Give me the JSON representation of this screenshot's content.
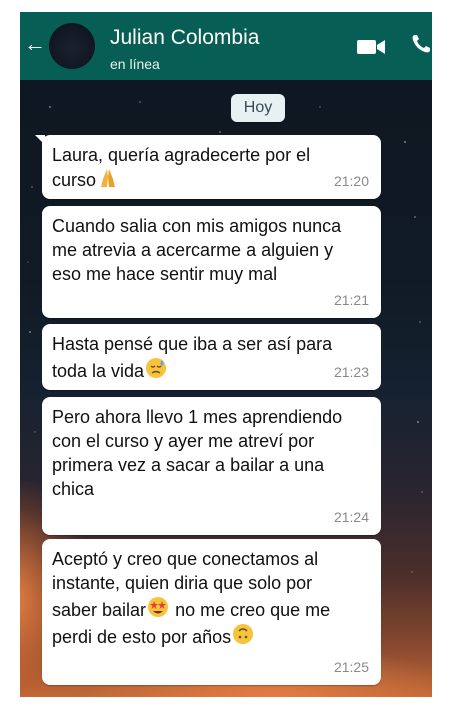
{
  "header": {
    "contact_name": "Julian Colombia",
    "status": "en línea",
    "back_icon": "arrow-left-icon",
    "video_icon": "video-call-icon",
    "call_icon": "phone-icon",
    "color": "#075e54"
  },
  "chat": {
    "date_label": "Hoy",
    "messages": [
      {
        "text": "Laura, quería agradecerte por el curso",
        "emoji": "folded-hands",
        "time": "21:20"
      },
      {
        "text": "Cuando salia con mis amigos nunca me atrevia a acercarme a alguien y eso me hace sentir muy mal",
        "time": "21:21"
      },
      {
        "text": "Hasta pensé que iba a ser así para toda la vida",
        "emoji": "sad-face-with-sweat",
        "time": "21:23"
      },
      {
        "text": "Pero ahora llevo 1 mes aprendiendo con el curso y ayer me atreví por primera vez a sacar a bailar a una chica",
        "time": "21:24"
      },
      {
        "text_a": "Aceptó y creo que conectamos al instante, quien diria que solo por saber bailar",
        "emoji_a": "star-struck",
        "text_b": " no me creo que me perdi de esto por años",
        "emoji_b": "upside-down-face",
        "time": "21:25"
      }
    ]
  }
}
